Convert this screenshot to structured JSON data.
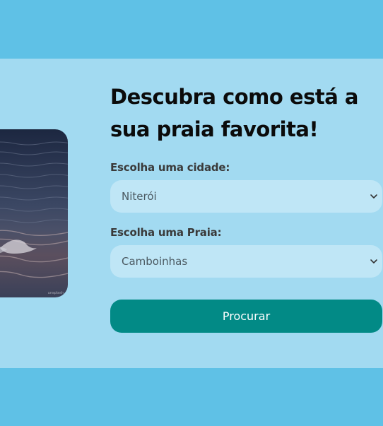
{
  "hero": {
    "title_line1": "Descubra como está a",
    "title_line2": "sua praia favorita!",
    "image_alt": "ocean waves at dusk"
  },
  "form": {
    "city_label": "Escolha uma cidade:",
    "city_value": "Niterói",
    "beach_label": "Escolha uma Praia:",
    "beach_value": "Camboinhas",
    "submit_label": "Procurar"
  },
  "colors": {
    "page_background": "#5fc1e6",
    "band_background": "#a2daf1",
    "field_background": "#bfe6f6",
    "button_background": "#028a86",
    "button_text": "#ffffff",
    "title_text": "#0b0b0b"
  },
  "icons": {
    "select_chevron": "chevron-down-icon"
  }
}
